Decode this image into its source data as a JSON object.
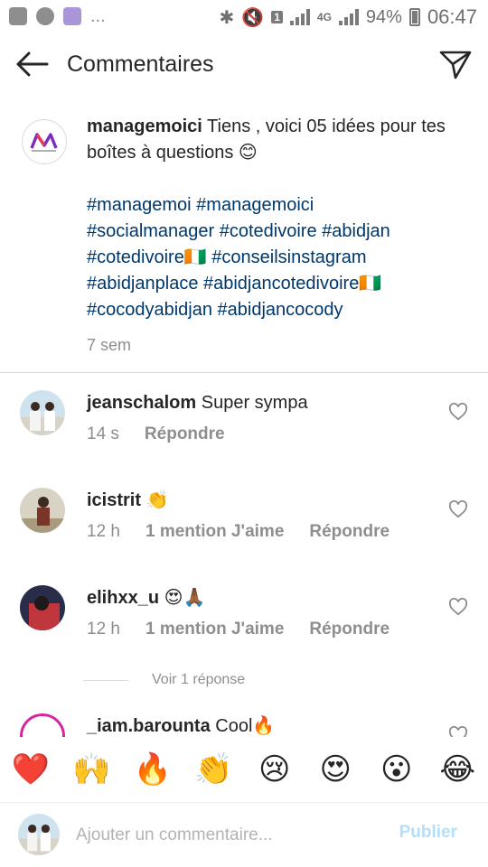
{
  "status_bar": {
    "left_icons": [
      "image-icon",
      "media-icon",
      "messenger-icon"
    ],
    "dots": "...",
    "network": "4G",
    "sim": "1",
    "battery": "94%",
    "time": "06:47"
  },
  "header": {
    "title": "Commentaires"
  },
  "caption": {
    "username": "managemoici",
    "text": "Tiens , voici 05 idées pour tes boîtes à questions 😊",
    "hashtag_lines": [
      "#managemoi #managemoici",
      "#socialmanager #cotedivoire #abidjan",
      "#cotedivoire🇨🇮 #conseilsinstagram",
      "#abidjanplace #abidjancotedivoire🇨🇮",
      "#cocodyabidjan #abidjancocody"
    ],
    "time": "7 sem"
  },
  "comments": [
    {
      "username": "jeanschalom",
      "text": "Super sympa",
      "time": "14 s",
      "likes": "",
      "reply": "Répondre"
    },
    {
      "username": "icistrit",
      "text": "👏",
      "time": "12 h",
      "likes": "1 mention J'aime",
      "reply": "Répondre"
    },
    {
      "username": "elihxx_u",
      "text": "😍🙏🏾",
      "time": "12 h",
      "likes": "1 mention J'aime",
      "reply": "Répondre"
    },
    {
      "username": "_iam.barounta",
      "text": "Cool🔥",
      "time": "",
      "likes": "",
      "reply": ""
    }
  ],
  "view_replies": "Voir 1 réponse",
  "emoji_bar": [
    "❤️",
    "🙌",
    "🔥",
    "👏",
    "😢",
    "😍",
    "😮",
    "😂"
  ],
  "composer": {
    "placeholder": "Ajouter un commentaire...",
    "publish": "Publier"
  },
  "colors": {
    "link": "#00376b",
    "meta": "#8e8e8e",
    "publish_disabled": "#b2dffc",
    "text": "#262626"
  }
}
